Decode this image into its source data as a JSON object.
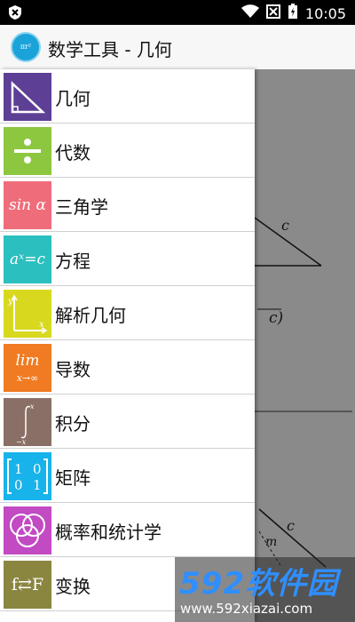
{
  "status_bar": {
    "time": "10:05"
  },
  "app_bar": {
    "logo_text": "πr²",
    "title": "数学工具 - 几何"
  },
  "menu": {
    "items": [
      {
        "label": "几何",
        "icon": "right-triangle-icon",
        "color": "#5e3f96"
      },
      {
        "label": "代数",
        "icon": "divide-icon",
        "color": "#8dc63f"
      },
      {
        "label": "三角学",
        "icon": "sin-alpha-icon",
        "tile_text": "sin α",
        "color": "#ef6d7a"
      },
      {
        "label": "方程",
        "icon": "exponent-equation-icon",
        "tile_text": "aˣ=c",
        "color": "#2bbfbf"
      },
      {
        "label": "解析几何",
        "icon": "axes-icon",
        "color": "#d8d81f"
      },
      {
        "label": "导数",
        "icon": "limit-icon",
        "tile_text_top": "lim",
        "tile_text_bottom": "x→∞",
        "color": "#f07b22"
      },
      {
        "label": "积分",
        "icon": "integral-icon",
        "color": "#8a6f66"
      },
      {
        "label": "矩阵",
        "icon": "matrix-icon",
        "tile_text": "1 0 0 1",
        "color": "#18b3ea"
      },
      {
        "label": "概率和统计学",
        "icon": "venn-diagram-icon",
        "color": "#c24ac3"
      },
      {
        "label": "变换",
        "icon": "transform-icon",
        "tile_text": "f⇄F",
        "color": "#8a8640"
      }
    ]
  },
  "background": {
    "math_fragment": "c)",
    "var_c": "c",
    "var_m": "m"
  },
  "watermark": {
    "big": "592软件园",
    "url": "www.592xiazai.com"
  }
}
